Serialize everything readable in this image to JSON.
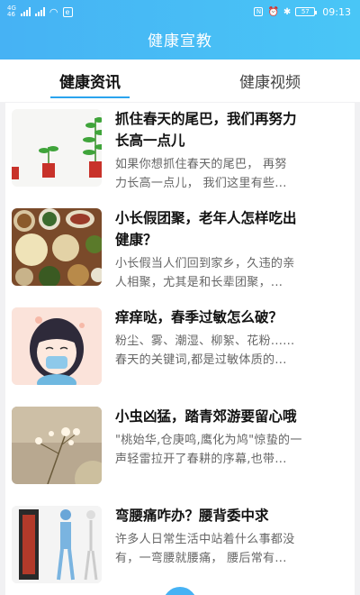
{
  "status": {
    "left_tiny_1": "4G",
    "left_tiny_2": "46",
    "time": "09:13",
    "battery": "57"
  },
  "header": {
    "title": "健康宣教"
  },
  "tabs": [
    {
      "label": "健康资讯",
      "active": true
    },
    {
      "label": "健康视频",
      "active": false
    }
  ],
  "articles": [
    {
      "title_line1": "抓住春天的尾巴，我们再努力",
      "title_line2": "长高一点儿",
      "desc_line1": "如果你想抓住春天的尾巴，  再努",
      "desc_line2": "力长高一点儿，  我们这里有些..."
    },
    {
      "title_line1": "小长假团聚，老年人怎样吃出",
      "title_line2": "健康？",
      "desc_line1": "小长假当人们回到家乡，久违的亲",
      "desc_line2": "人相聚，尤其是和长辈团聚，..."
    },
    {
      "title_line1": "痒痒哒，春季过敏怎么破？",
      "title_line2": "",
      "desc_line1": "粉尘、雾、潮湿、柳絮、花粉......",
      "desc_line2": "春天的关键词,都是过敏体质的..."
    },
    {
      "title_line1": "小虫凶猛，踏青郊游要留心哦",
      "title_line2": "",
      "desc_line1": "\"桃始华,仓庚鸣,鹰化为鸠\"惊蛰的一",
      "desc_line2": "声轻雷拉开了春耕的序幕,也带..."
    },
    {
      "title_line1": "弯腰痛咋办？腰背委中求",
      "title_line2": "",
      "desc_line1": "许多人日常生活中站着什么事都没",
      "desc_line2": "有，一弯腰就腰痛，  腰后常有..."
    }
  ]
}
